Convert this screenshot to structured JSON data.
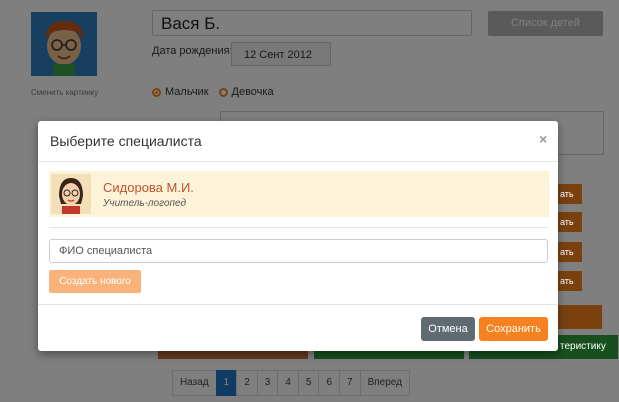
{
  "profile": {
    "name": "Вася Б.",
    "change_picture": "Сменить картинку",
    "kids_list_button": "Список детей",
    "dob_label": "Дата рождения:",
    "dob_value": "12 Сент 2012",
    "gender_boy": "Мальчик",
    "gender_girl": "Девочка"
  },
  "background_buttons": {
    "side_button_text": "ать",
    "characteristic_text": "теристику"
  },
  "pagination": {
    "prev": "Назад",
    "pages": [
      "1",
      "2",
      "3",
      "4",
      "5",
      "6",
      "7"
    ],
    "active": "1",
    "next": "Вперед"
  },
  "modal": {
    "title": "Выберите специалиста",
    "close_glyph": "×",
    "specialist": {
      "name": "Сидорова М.И.",
      "role": "Учитель-логопед"
    },
    "fio_placeholder": "ФИО специалиста",
    "create_button": "Создать нового",
    "cancel_button": "Отмена",
    "save_button": "Сохранить"
  },
  "colors": {
    "accent": "#f5821f",
    "cancel": "#5f6b71",
    "green": "#2e9e3e",
    "pagination_active": "#1f77c9"
  }
}
